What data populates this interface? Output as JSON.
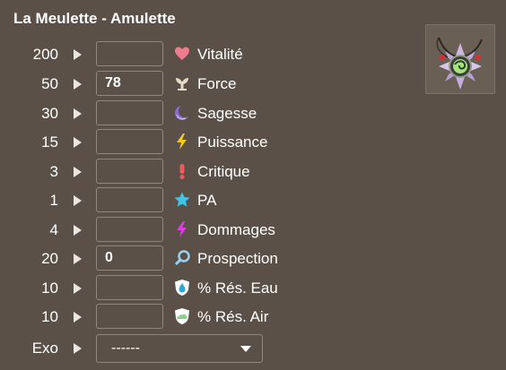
{
  "title": "La Meulette - Amulette",
  "item_image_icon": "amulet-icon",
  "rows": [
    {
      "value": "200",
      "input_value": "",
      "icon": "heart-icon",
      "label": "Vitalité"
    },
    {
      "value": "50",
      "input_value": "78",
      "icon": "force-icon",
      "label": "Force"
    },
    {
      "value": "30",
      "input_value": "",
      "icon": "moon-icon",
      "label": "Sagesse"
    },
    {
      "value": "15",
      "input_value": "",
      "icon": "lightning-icon",
      "label": "Puissance"
    },
    {
      "value": "3",
      "input_value": "",
      "icon": "exclamation-icon",
      "label": "Critique"
    },
    {
      "value": "1",
      "input_value": "",
      "icon": "star-icon",
      "label": "PA"
    },
    {
      "value": "4",
      "input_value": "",
      "icon": "lightning-pink-icon",
      "label": "Dommages"
    },
    {
      "value": "20",
      "input_value": "0",
      "icon": "magnifier-icon",
      "label": "Prospection"
    },
    {
      "value": "10",
      "input_value": "",
      "icon": "water-shield-icon",
      "label": "% Rés. Eau"
    },
    {
      "value": "10",
      "input_value": "",
      "icon": "air-shield-icon",
      "label": "% Rés. Air"
    }
  ],
  "exo": {
    "label": "Exo",
    "selected": "------"
  }
}
